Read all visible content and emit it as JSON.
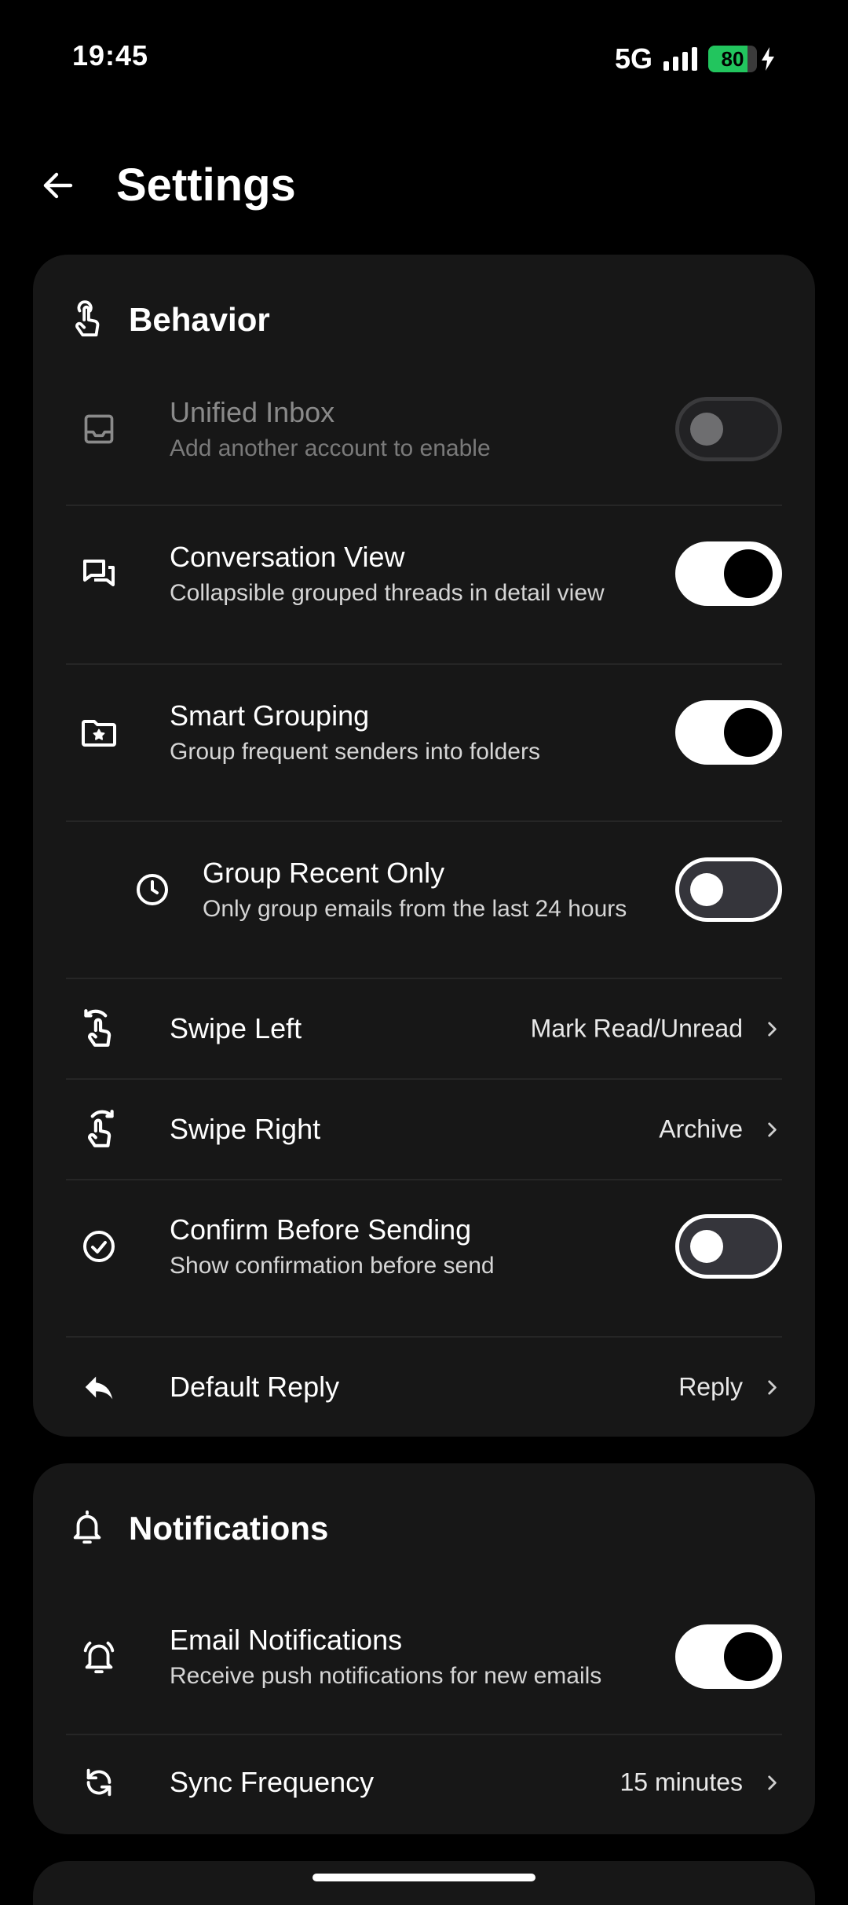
{
  "status_bar": {
    "time": "19:45",
    "network": "5G",
    "battery": "80",
    "battery_level": 0.8
  },
  "header": {
    "title": "Settings"
  },
  "behavior": {
    "title": "Behavior",
    "unified_inbox": {
      "title": "Unified Inbox",
      "subtitle": "Add another account to enable",
      "state": "disabled"
    },
    "conversation_view": {
      "title": "Conversation View",
      "subtitle": "Collapsible grouped threads in detail view",
      "state": "on"
    },
    "smart_grouping": {
      "title": "Smart Grouping",
      "subtitle": "Group frequent senders into folders",
      "state": "on"
    },
    "group_recent_only": {
      "title": "Group Recent Only",
      "subtitle": "Only group emails from the last 24 hours",
      "state": "off"
    },
    "swipe_left": {
      "title": "Swipe Left",
      "value": "Mark Read/Unread"
    },
    "swipe_right": {
      "title": "Swipe Right",
      "value": "Archive"
    },
    "confirm_before_sending": {
      "title": "Confirm Before Sending",
      "subtitle": "Show confirmation before send",
      "state": "off"
    },
    "default_reply": {
      "title": "Default Reply",
      "value": "Reply"
    }
  },
  "notifications": {
    "title": "Notifications",
    "email_notifications": {
      "title": "Email Notifications",
      "subtitle": "Receive push notifications for new emails",
      "state": "on"
    },
    "sync_frequency": {
      "title": "Sync Frequency",
      "value": "15 minutes"
    }
  },
  "icons": {
    "back": "arrow-left-icon",
    "behavior": "touch-hand-icon",
    "unified_inbox": "inbox-icon",
    "conversation_view": "chat-bubbles-icon",
    "smart_grouping": "folder-star-icon",
    "group_recent_only": "clock-icon",
    "swipe_left": "swipe-left-icon",
    "swipe_right": "swipe-right-icon",
    "confirm_before_sending": "check-circle-icon",
    "default_reply": "reply-icon",
    "notifications": "bell-icon",
    "email_notifications": "bell-ring-icon",
    "sync_frequency": "sync-icon",
    "chevron": "chevron-right-icon"
  },
  "colors": {
    "background": "#000000",
    "card": "#171717",
    "battery": "#22c55e",
    "toggle_on": "#ffffff"
  }
}
